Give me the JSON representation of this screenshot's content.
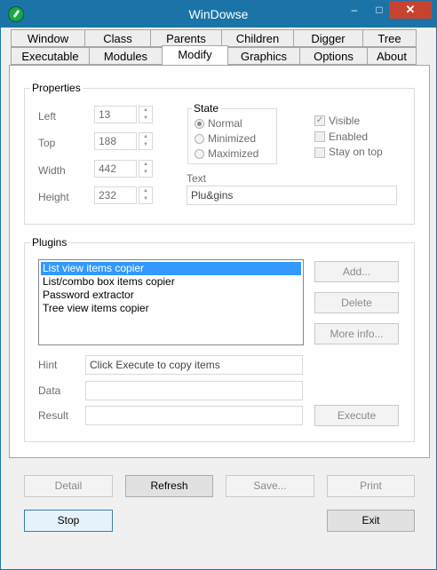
{
  "window": {
    "title": "WinDowse",
    "minimize": "–",
    "maximize": "□",
    "close": "✕"
  },
  "tabs_row1": [
    "Window",
    "Class",
    "Parents",
    "Children",
    "Digger",
    "Tree"
  ],
  "tabs_row2": [
    "Executable",
    "Modules",
    "Modify",
    "Graphics",
    "Options",
    "About"
  ],
  "properties": {
    "legend": "Properties",
    "left": {
      "label": "Left",
      "value": "13"
    },
    "top": {
      "label": "Top",
      "value": "188"
    },
    "width": {
      "label": "Width",
      "value": "442"
    },
    "height": {
      "label": "Height",
      "value": "232"
    },
    "state": {
      "legend": "State",
      "normal": "Normal",
      "minimized": "Minimized",
      "maximized": "Maximized",
      "selected": "Normal"
    },
    "visible": {
      "label": "Visible",
      "checked": true
    },
    "enabled": {
      "label": "Enabled",
      "checked": false
    },
    "stay_on_top": {
      "label": "Stay on top",
      "checked": false
    },
    "text": {
      "label": "Text",
      "value": "Plu&gins"
    }
  },
  "plugins": {
    "legend": "Plugins",
    "items": [
      "List view items copier",
      "List/combo box items copier",
      "Password extractor",
      "Tree view items copier"
    ],
    "selected_index": 0,
    "add": "Add...",
    "delete": "Delete",
    "more_info": "More info...",
    "hint": {
      "label": "Hint",
      "value": "Click Execute to copy items"
    },
    "data": {
      "label": "Data",
      "value": ""
    },
    "result": {
      "label": "Result",
      "value": ""
    },
    "execute": "Execute"
  },
  "bottom": {
    "detail": "Detail",
    "refresh": "Refresh",
    "save": "Save...",
    "print": "Print",
    "stop": "Stop",
    "exit": "Exit"
  }
}
